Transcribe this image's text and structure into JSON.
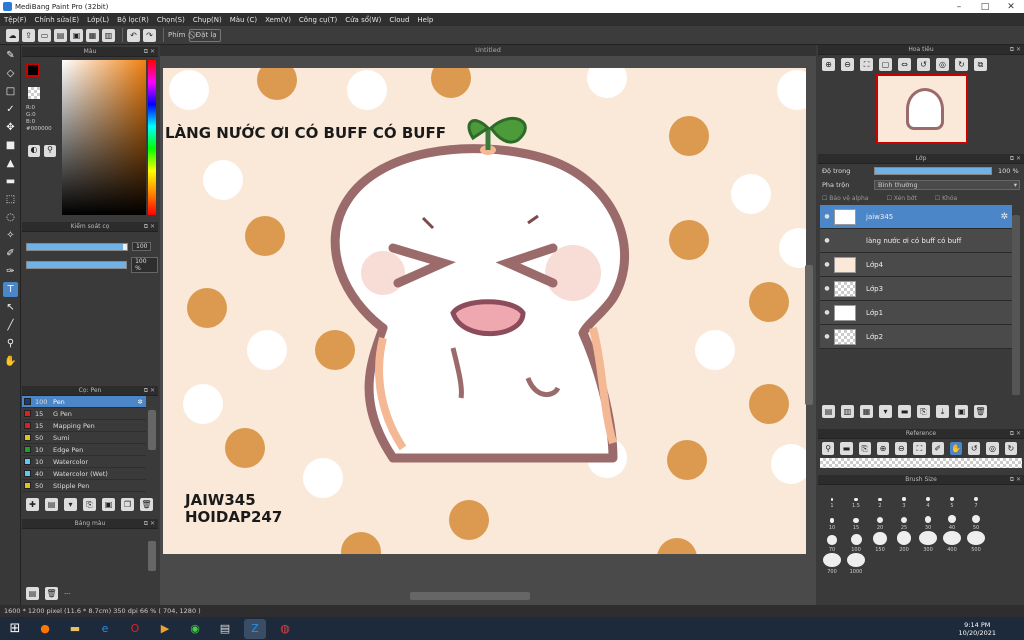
{
  "window": {
    "title": "MediBang Paint Pro (32bit)"
  },
  "menu": [
    "Tệp(F)",
    "Chỉnh sửa(E)",
    "Lớp(L)",
    "Bộ lọc(R)",
    "Chọn(S)",
    "Chụp(N)",
    "Màu (C)",
    "Xem(V)",
    "Công cụ(T)",
    "Cửa sổ(W)",
    "Cloud",
    "Help"
  ],
  "toolbar": {
    "brush_label": "Phím",
    "deselect_label": "Đặt lạ"
  },
  "color_panel": {
    "title": "Màu",
    "r": "R:0",
    "g": "G:0",
    "b": "B:0",
    "hex": "#000000"
  },
  "brush_control": {
    "title": "Kiểm soát cọ",
    "size_value": "100",
    "opacity_value": "100 %",
    "size_fraction": 0.96,
    "opacity_fraction": 1.0
  },
  "brush_list": {
    "title": "Cọ: Pen",
    "items": [
      {
        "size": "100",
        "name": "Pen",
        "color": "#1a3b7a"
      },
      {
        "size": "15",
        "name": "G Pen",
        "color": "#e02020"
      },
      {
        "size": "15",
        "name": "Mapping Pen",
        "color": "#e02020"
      },
      {
        "size": "50",
        "name": "Sumi",
        "color": "#e0c020"
      },
      {
        "size": "10",
        "name": "Edge Pen",
        "color": "#20a020"
      },
      {
        "size": "10",
        "name": "Watercolor",
        "color": "#60c8f0"
      },
      {
        "size": "40",
        "name": "Watercolor (Wet)",
        "color": "#60c8f0"
      },
      {
        "size": "50",
        "name": "Stipple Pen",
        "color": "#e0c020"
      }
    ]
  },
  "palette": {
    "title": "Bảng màu",
    "footer": "---"
  },
  "canvas": {
    "tab_title": "Untitled",
    "caption_top": "LÀNG NƯỚC ƠI CÓ BUFF CÓ BUFF",
    "signature_line1": "JAIW345",
    "signature_line2": "HOIDAP247"
  },
  "navigator": {
    "title": "Hoa tiêu"
  },
  "layer_panel": {
    "title": "Lớp",
    "opacity_label": "Độ trong",
    "opacity_value": "100 %",
    "blend_label": "Pha trộn",
    "blend_value": "Bình thường",
    "protect_alpha": "Bảo vệ alpha",
    "clipping": "Xén bớt",
    "lock": "Khóa",
    "layers": [
      {
        "name": "jaiw345",
        "selected": true
      },
      {
        "name": "làng nước ơi có buff có buff",
        "selected": false
      },
      {
        "name": "Lớp4",
        "selected": false
      },
      {
        "name": "Lớp3",
        "selected": false
      },
      {
        "name": "Lớp1",
        "selected": false
      },
      {
        "name": "Lớp2",
        "selected": false
      }
    ]
  },
  "reference": {
    "title": "Reference"
  },
  "brush_size": {
    "title": "Brush Size",
    "sizes": [
      "1",
      "1.5",
      "2",
      "3",
      "4",
      "5",
      "7",
      "10",
      "15",
      "20",
      "25",
      "30",
      "40",
      "50",
      "70",
      "100",
      "150",
      "200",
      "300",
      "400",
      "500",
      "700",
      "1000"
    ]
  },
  "status": {
    "text": "1600 * 1200 pixel   (11.6 * 8.7cm)   350 dpi   66 %   ( 704, 1280 )"
  },
  "taskbar": {
    "time": "9:14 PM",
    "date": "10/20/2021"
  },
  "colors": {
    "accent": "#4a86c8",
    "canvas_bg": "#fae9d8",
    "dot_orange": "#db9a4f",
    "outline": "#9b6b6b"
  }
}
